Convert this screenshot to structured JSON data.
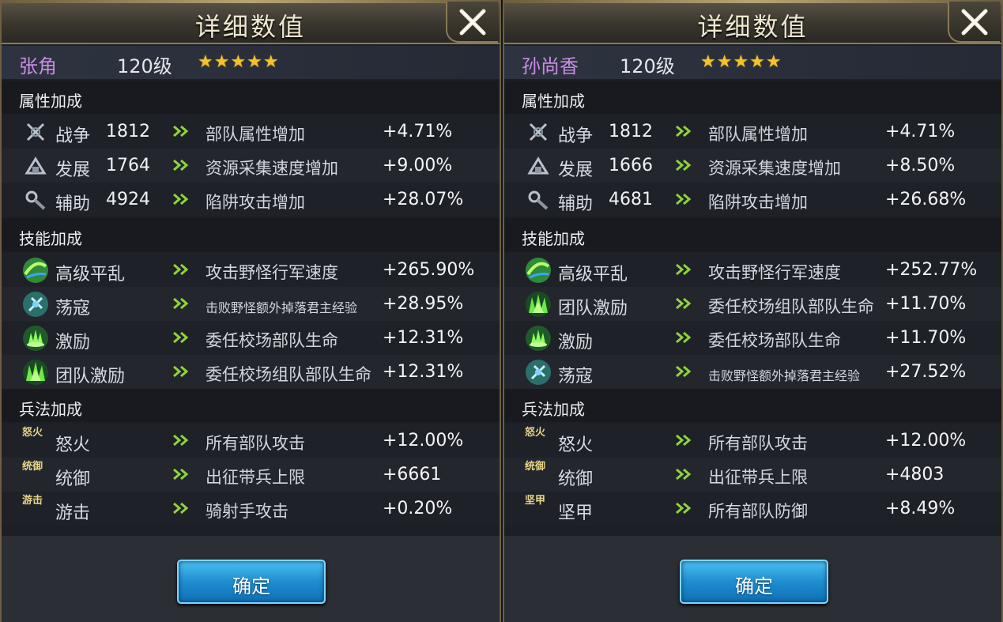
{
  "panels": [
    {
      "title": "详细数值",
      "hero": {
        "name": "张角",
        "level": "120级",
        "stars": "★★★★★"
      },
      "sections": {
        "attributes": "属性加成",
        "skills": "技能加成",
        "tactics": "兵法加成"
      },
      "attributes": [
        {
          "icon": "war-icon",
          "name": "战争",
          "value": "1812",
          "desc": "部队属性增加",
          "bonus": "+4.71%"
        },
        {
          "icon": "development-icon",
          "name": "发展",
          "value": "1764",
          "desc": "资源采集速度增加",
          "bonus": "+9.00%"
        },
        {
          "icon": "support-icon",
          "name": "辅助",
          "value": "4924",
          "desc": "陷阱攻击增加",
          "bonus": "+28.07%"
        }
      ],
      "skills": [
        {
          "icon": "advanced-pacify-icon",
          "name": "高级平乱",
          "desc": "攻击野怪行军速度",
          "bonus": "+265.90%",
          "small": false
        },
        {
          "icon": "raid-icon",
          "name": "荡寇",
          "desc": "击败野怪额外掉落君主经验",
          "bonus": "+28.95%",
          "small": true
        },
        {
          "icon": "inspire-icon",
          "name": "激励",
          "desc": "委任校场部队生命",
          "bonus": "+12.31%",
          "small": false
        },
        {
          "icon": "team-inspire-icon",
          "name": "团队激励",
          "desc": "委任校场组队部队生命",
          "bonus": "+12.31%",
          "small": false
        }
      ],
      "tactics": [
        {
          "icon": "rage-icon",
          "glyph": "怒火",
          "name": "怒火",
          "desc": "所有部队攻击",
          "bonus": "+12.00%"
        },
        {
          "icon": "command-icon",
          "glyph": "统御",
          "name": "统御",
          "desc": "出征带兵上限",
          "bonus": "+6661"
        },
        {
          "icon": "skirmish-icon",
          "glyph": "游击",
          "name": "游击",
          "desc": "骑射手攻击",
          "bonus": "+0.20%"
        }
      ],
      "confirm": "确定"
    },
    {
      "title": "详细数值",
      "hero": {
        "name": "孙尚香",
        "level": "120级",
        "stars": "★★★★★"
      },
      "sections": {
        "attributes": "属性加成",
        "skills": "技能加成",
        "tactics": "兵法加成"
      },
      "attributes": [
        {
          "icon": "war-icon",
          "name": "战争",
          "value": "1812",
          "desc": "部队属性增加",
          "bonus": "+4.71%"
        },
        {
          "icon": "development-icon",
          "name": "发展",
          "value": "1666",
          "desc": "资源采集速度增加",
          "bonus": "+8.50%"
        },
        {
          "icon": "support-icon",
          "name": "辅助",
          "value": "4681",
          "desc": "陷阱攻击增加",
          "bonus": "+26.68%"
        }
      ],
      "skills": [
        {
          "icon": "advanced-pacify-icon",
          "name": "高级平乱",
          "desc": "攻击野怪行军速度",
          "bonus": "+252.77%",
          "small": false
        },
        {
          "icon": "team-inspire-icon",
          "name": "团队激励",
          "desc": "委任校场组队部队生命",
          "bonus": "+11.70%",
          "small": false
        },
        {
          "icon": "inspire-icon",
          "name": "激励",
          "desc": "委任校场部队生命",
          "bonus": "+11.70%",
          "small": false
        },
        {
          "icon": "raid-icon",
          "name": "荡寇",
          "desc": "击败野怪额外掉落君主经验",
          "bonus": "+27.52%",
          "small": true
        }
      ],
      "tactics": [
        {
          "icon": "rage-icon",
          "glyph": "怒火",
          "name": "怒火",
          "desc": "所有部队攻击",
          "bonus": "+12.00%"
        },
        {
          "icon": "command-icon",
          "glyph": "统御",
          "name": "统御",
          "desc": "出征带兵上限",
          "bonus": "+4803"
        },
        {
          "icon": "armor-icon",
          "glyph": "坚甲",
          "name": "坚甲",
          "desc": "所有部队防御",
          "bonus": "+8.49%"
        }
      ],
      "confirm": "确定"
    }
  ]
}
